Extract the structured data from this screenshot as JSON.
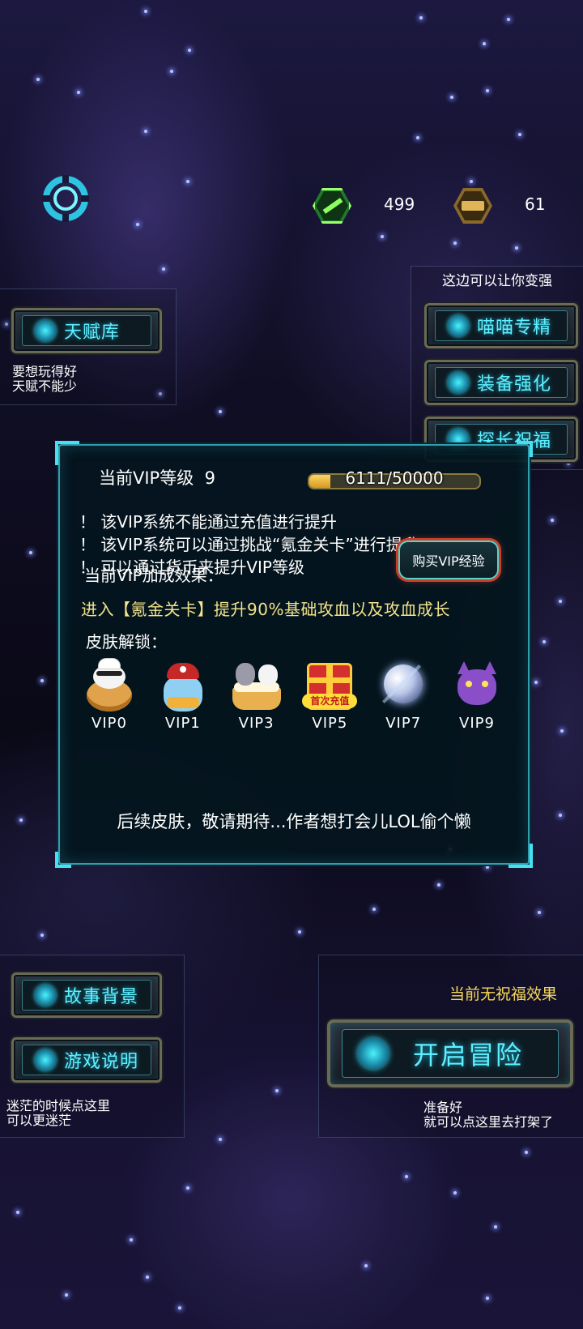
{
  "resources": {
    "green_value": "499",
    "gold_value": "61"
  },
  "right_panel": {
    "title": "这边可以让你变强",
    "buttons": [
      "喵喵专精",
      "装备强化",
      "探长祝福"
    ]
  },
  "left_panel": {
    "button": "天赋库",
    "note_line1": "要想玩得好",
    "note_line2": "天赋不能少"
  },
  "vip_dialog": {
    "level_label": "当前VIP等级",
    "level_value": "9",
    "progress_text": "6111/50000",
    "progress_fraction": 0.12222,
    "rules": [
      "！ 该VIP系统不能通过充值进行提升",
      "！ 该VIP系统可以通过挑战“氪金关卡”进行提升",
      "！ 可以通过货币来提升VIP等级"
    ],
    "buy_button": "购买VIP经验",
    "bonus_title": "当前VIP加成效果：",
    "bonus_text": "进入【氪金关卡】提升90%基础攻血以及攻血成长",
    "skins_title": "皮肤解锁：",
    "skins": [
      {
        "label": "VIP0",
        "icon": "chef-cat-bun-icon"
      },
      {
        "label": "VIP1",
        "icon": "pirate-cat-icon"
      },
      {
        "label": "VIP3",
        "icon": "cats-in-cake-icon"
      },
      {
        "label": "VIP5",
        "icon": "first-recharge-gift-icon",
        "badge": "首次充值"
      },
      {
        "label": "VIP7",
        "icon": "crystal-orb-icon"
      },
      {
        "label": "VIP9",
        "icon": "purple-devil-cat-icon"
      }
    ],
    "footer_note": "后续皮肤，敬请期待...作者想打会儿LOL偷个懒"
  },
  "bottom_left": {
    "buttons": [
      "故事背景",
      "游戏说明"
    ],
    "note_line1": "迷茫的时候点这里",
    "note_line2": "可以更迷茫"
  },
  "bottom_right": {
    "status": "当前无祝福效果",
    "adventure_button": "开启冒险",
    "note_line1": "准备好",
    "note_line2": "就可以点这里去打架了"
  },
  "colors": {
    "accent_cyan": "#5ef0ff",
    "bonus_yellow": "#f2e48a",
    "status_yellow": "#f6d85a",
    "progress_gold": "#e0a92a"
  }
}
